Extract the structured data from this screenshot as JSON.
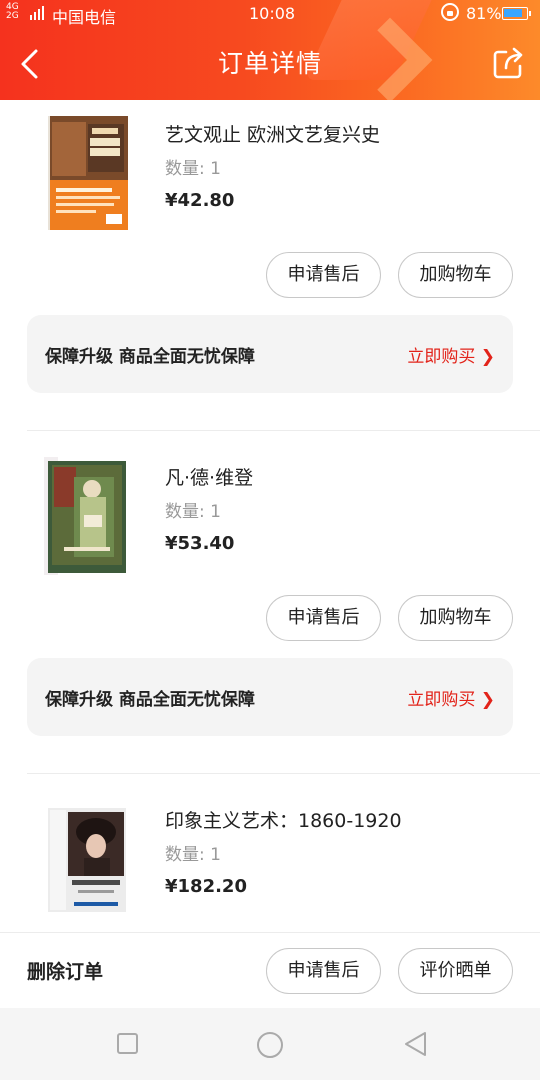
{
  "status_bar": {
    "network": "4G",
    "network2": "2G",
    "carrier": "中国电信",
    "time": "10:08",
    "battery": "81%"
  },
  "header": {
    "title": "订单详情"
  },
  "items": [
    {
      "title": "艺文观止 欧洲文艺复兴史",
      "quantity": "数量: 1",
      "price": "¥42.80",
      "after_sale_label": "申请售后",
      "add_cart_label": "加购物车",
      "guarantee_text": "保障升级  商品全面无忧保障",
      "buy_now_label": "立即购买 ❯"
    },
    {
      "title": "凡·德·维登",
      "quantity": "数量: 1",
      "price": "¥53.40",
      "after_sale_label": "申请售后",
      "add_cart_label": "加购物车",
      "guarantee_text": "保障升级  商品全面无忧保障",
      "buy_now_label": "立即购买 ❯"
    },
    {
      "title": "印象主义艺术：1860-1920",
      "quantity": "数量: 1",
      "price": "¥182.20"
    }
  ],
  "bottom_bar": {
    "delete_label": "删除订单",
    "after_sale_label": "申请售后",
    "review_label": "评价晒单"
  },
  "colors": {
    "header_start": "#f5321e",
    "header_end": "#fd8a2a",
    "accent_red": "#e2231a"
  },
  "icons": [
    "back-arrow-icon",
    "share-icon",
    "square-nav-icon",
    "circle-nav-icon",
    "triangle-back-icon"
  ]
}
